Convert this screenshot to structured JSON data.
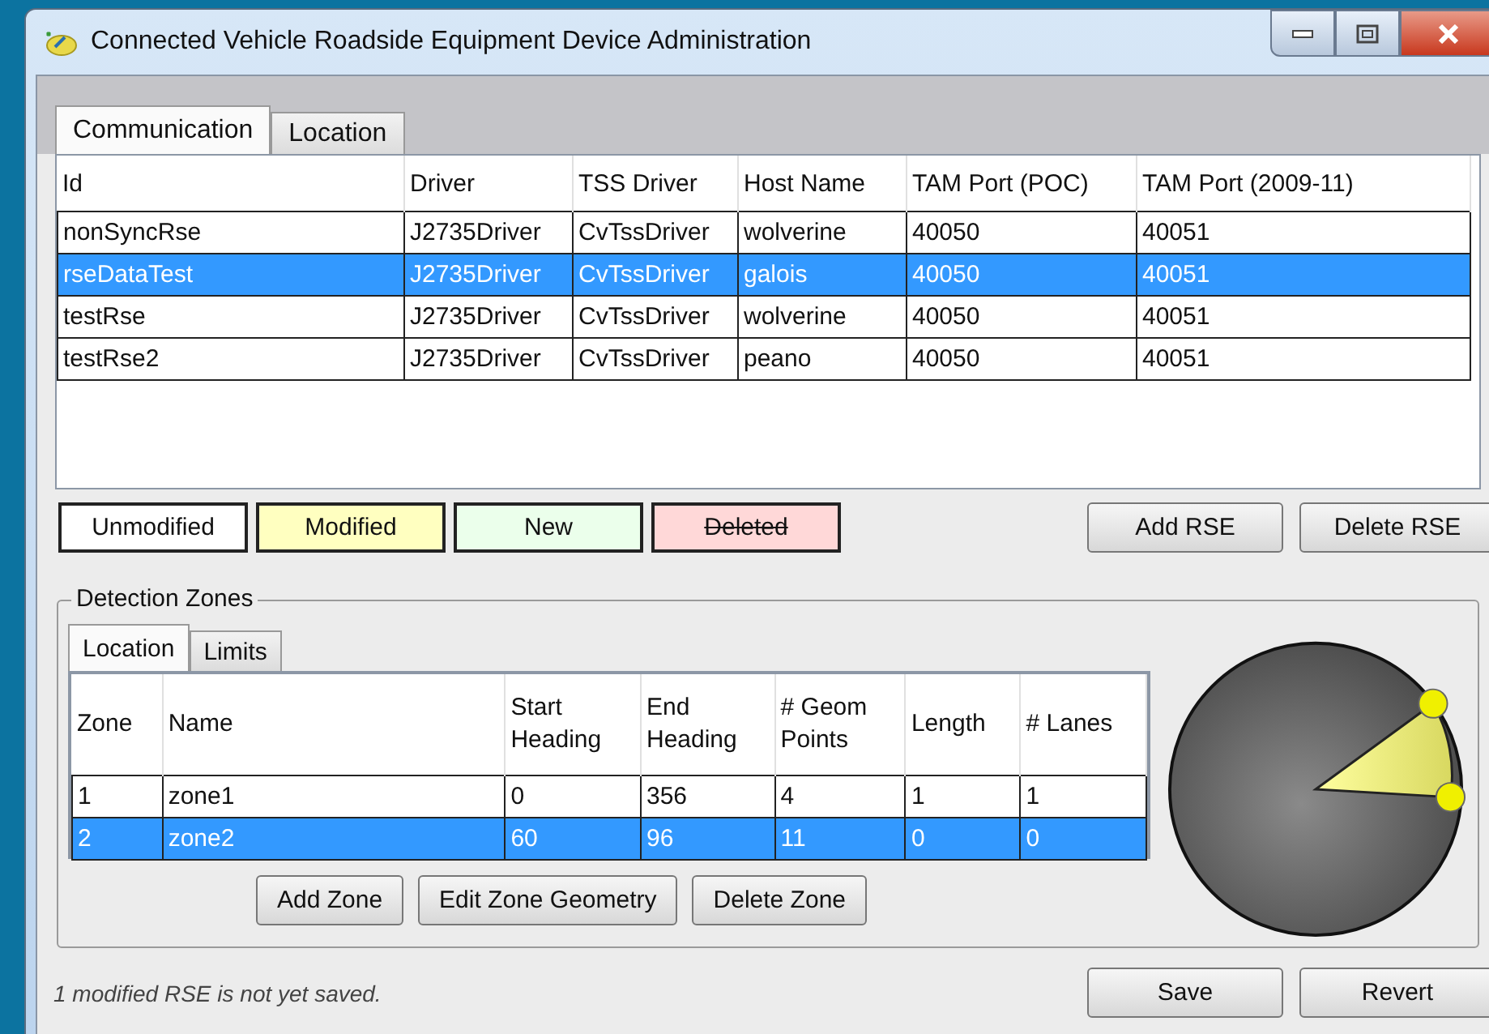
{
  "window": {
    "title": "Connected Vehicle Roadside Equipment Device Administration"
  },
  "tabs": [
    {
      "label": "Communication",
      "selected": true
    },
    {
      "label": "Location",
      "selected": false
    }
  ],
  "rse_table": {
    "columns": [
      "Id",
      "Driver",
      "TSS Driver",
      "Host Name",
      "TAM Port (POC)",
      "TAM Port (2009-11)"
    ],
    "rows": [
      {
        "cells": [
          "nonSyncRse",
          "J2735Driver",
          "CvTssDriver",
          "wolverine",
          "40050",
          "40051"
        ],
        "selected": false
      },
      {
        "cells": [
          "rseDataTest",
          "J2735Driver",
          "CvTssDriver",
          "galois",
          "40050",
          "40051"
        ],
        "selected": true
      },
      {
        "cells": [
          "testRse",
          "J2735Driver",
          "CvTssDriver",
          "wolverine",
          "40050",
          "40051"
        ],
        "selected": false
      },
      {
        "cells": [
          "testRse2",
          "J2735Driver",
          "CvTssDriver",
          "peano",
          "40050",
          "40051"
        ],
        "selected": false
      }
    ]
  },
  "legend": [
    {
      "label": "Unmodified",
      "color": "#ffffff",
      "kind": "plain"
    },
    {
      "label": "Modified",
      "color": "#ffffc0",
      "kind": "plain"
    },
    {
      "label": "New",
      "color": "#ebffeb",
      "kind": "plain"
    },
    {
      "label": "Deleted",
      "color": "#ffd8d8",
      "kind": "struck"
    }
  ],
  "rse_buttons": [
    "Add RSE",
    "Delete RSE"
  ],
  "detection_zones": {
    "title": "Detection Zones",
    "tabs": [
      {
        "label": "Location",
        "selected": true
      },
      {
        "label": "Limits",
        "selected": false
      }
    ],
    "columns": [
      "Zone",
      "Name",
      "Start Heading",
      "End Heading",
      "# Geom Points",
      "Length",
      "# Lanes"
    ],
    "rows": [
      {
        "cells": [
          "1",
          "zone1",
          "0",
          "356",
          "4",
          "1",
          "1"
        ],
        "selected": false
      },
      {
        "cells": [
          "2",
          "zone2",
          "60",
          "96",
          "11",
          "0",
          "0"
        ],
        "selected": true
      }
    ],
    "buttons": [
      "Add Zone",
      "Edit Zone Geometry",
      "Delete Zone"
    ]
  },
  "status_message": "1 modified RSE is not yet saved.",
  "buttons": [
    "Save",
    "Revert"
  ]
}
